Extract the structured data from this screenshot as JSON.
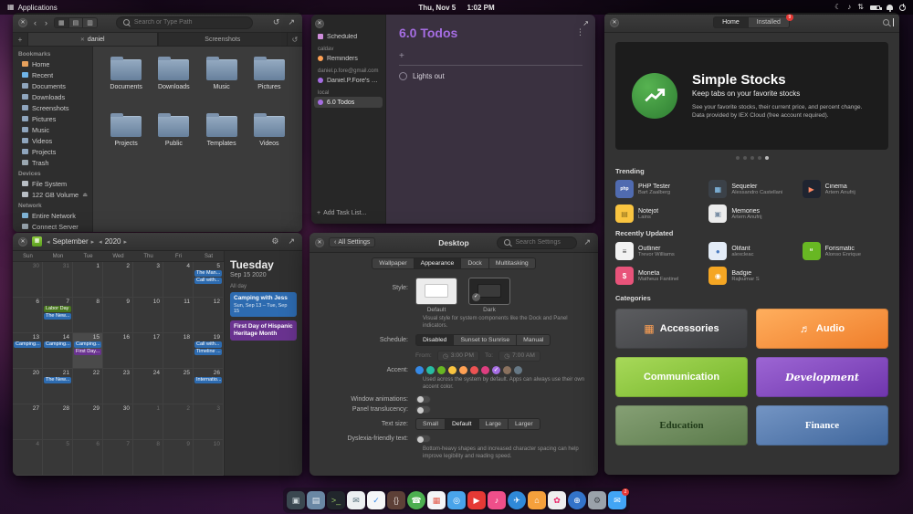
{
  "accent": "#a56de2",
  "panel": {
    "applications_label": "Applications",
    "date": "Thu, Nov 5",
    "time": "1:02 PM"
  },
  "files": {
    "search_placeholder": "Search or Type Path",
    "tabs": [
      {
        "label": "daniel",
        "active": true
      },
      {
        "label": "Screenshots",
        "active": false
      }
    ],
    "sidebar": [
      {
        "header": "Bookmarks",
        "items": [
          {
            "label": "Home",
            "icon": "home",
            "color": "#e7a15c"
          },
          {
            "label": "Recent",
            "icon": "recent",
            "color": "#6fb4e8"
          },
          {
            "label": "Documents",
            "icon": "folder",
            "color": "#8fa5bd"
          },
          {
            "label": "Downloads",
            "icon": "folder",
            "color": "#8fa5bd"
          },
          {
            "label": "Screenshots",
            "icon": "folder",
            "color": "#8fa5bd"
          },
          {
            "label": "Pictures",
            "icon": "folder",
            "color": "#8fa5bd"
          },
          {
            "label": "Music",
            "icon": "folder",
            "color": "#8fa5bd"
          },
          {
            "label": "Videos",
            "icon": "folder",
            "color": "#8fa5bd"
          },
          {
            "label": "Projects",
            "icon": "folder",
            "color": "#8fa5bd"
          },
          {
            "label": "Trash",
            "icon": "trash",
            "color": "#9aa7b0"
          }
        ]
      },
      {
        "header": "Devices",
        "items": [
          {
            "label": "File System",
            "icon": "drive",
            "color": "#b8bec4"
          },
          {
            "label": "122 GB Volume",
            "icon": "drive",
            "color": "#b8bec4",
            "eject": true
          }
        ]
      },
      {
        "header": "Network",
        "items": [
          {
            "label": "Entire Network",
            "icon": "network",
            "color": "#7fb3d5"
          },
          {
            "label": "Connect Server",
            "icon": "server",
            "color": "#9aa7b0"
          }
        ]
      }
    ],
    "folders": [
      "Documents",
      "Downloads",
      "Music",
      "Pictures",
      "Projects",
      "Public",
      "Templates",
      "Videos"
    ]
  },
  "tasks": {
    "title": "6.0 Todos",
    "add_list_label": "Add Task List...",
    "sidebar": [
      {
        "type": "item",
        "label": "Scheduled",
        "dot": "#cf8ddb",
        "square": true
      },
      {
        "type": "header",
        "label": "caldav"
      },
      {
        "type": "item",
        "label": "Reminders",
        "dot": "#ffa154"
      },
      {
        "type": "header",
        "label": "daniel.p.fore@gmail.com"
      },
      {
        "type": "item",
        "label": "Daniel.P.Fore's list",
        "dot": "#a56de2"
      },
      {
        "type": "header",
        "label": "local"
      },
      {
        "type": "item",
        "label": "6.0 Todos",
        "dot": "#a56de2",
        "selected": true
      }
    ],
    "todos": [
      {
        "label": "Lights out",
        "done": false
      }
    ]
  },
  "calendar": {
    "month": "September",
    "year": "2020",
    "weekdays": [
      "Sun",
      "Mon",
      "Tue",
      "Wed",
      "Thu",
      "Fri",
      "Sat"
    ],
    "weeks": [
      [
        {
          "d": 30,
          "dim": true
        },
        {
          "d": 31,
          "dim": true
        },
        {
          "d": 1
        },
        {
          "d": 2
        },
        {
          "d": 3
        },
        {
          "d": 4
        },
        {
          "d": 5,
          "events": [
            {
              "t": "The Man...",
              "c": "blue"
            },
            {
              "t": "Call with...",
              "c": "blue"
            }
          ]
        }
      ],
      [
        {
          "d": 6
        },
        {
          "d": 7,
          "events": [
            {
              "t": "Labor Day",
              "c": "green"
            },
            {
              "t": "The New...",
              "c": "blue"
            }
          ]
        },
        {
          "d": 8
        },
        {
          "d": 9
        },
        {
          "d": 10
        },
        {
          "d": 11
        },
        {
          "d": 12
        }
      ],
      [
        {
          "d": 13,
          "events": [
            {
              "t": "Camping...",
              "c": "blue"
            }
          ]
        },
        {
          "d": 14,
          "events": [
            {
              "t": "Camping...",
              "c": "blue"
            }
          ]
        },
        {
          "d": 15,
          "selected": true,
          "events": [
            {
              "t": "Camping...",
              "c": "blue"
            },
            {
              "t": "First Day...",
              "c": "purple"
            }
          ]
        },
        {
          "d": 16
        },
        {
          "d": 17
        },
        {
          "d": 18
        },
        {
          "d": 19,
          "events": [
            {
              "t": "Call with...",
              "c": "blue"
            },
            {
              "t": "Timeline ...",
              "c": "blue"
            }
          ]
        }
      ],
      [
        {
          "d": 20
        },
        {
          "d": 21,
          "events": [
            {
              "t": "The New...",
              "c": "blue"
            }
          ]
        },
        {
          "d": 22
        },
        {
          "d": 23
        },
        {
          "d": 24
        },
        {
          "d": 25
        },
        {
          "d": 26,
          "events": [
            {
              "t": "Internatio...",
              "c": "blue"
            }
          ]
        }
      ],
      [
        {
          "d": 27
        },
        {
          "d": 28
        },
        {
          "d": 29
        },
        {
          "d": 30
        },
        {
          "d": 1,
          "dim": true
        },
        {
          "d": 2,
          "dim": true
        },
        {
          "d": 3,
          "dim": true
        }
      ],
      [
        {
          "d": 4,
          "dim": true
        },
        {
          "d": 5,
          "dim": true
        },
        {
          "d": 6,
          "dim": true
        },
        {
          "d": 7,
          "dim": true
        },
        {
          "d": 8,
          "dim": true
        },
        {
          "d": 9,
          "dim": true
        },
        {
          "d": 10,
          "dim": true
        }
      ]
    ],
    "agenda": {
      "weekday": "Tuesday",
      "date": "Sep 15 2020",
      "allday_label": "All day",
      "events": [
        {
          "title": "Camping with Jess",
          "detail": "Sun, Sep 13 – Tue, Sep 15",
          "color": "blue"
        },
        {
          "title": "First Day of Hispanic Heritage Month",
          "detail": "",
          "color": "purple"
        }
      ]
    }
  },
  "settings": {
    "back_label": "All Settings",
    "title": "Desktop",
    "search_placeholder": "Search Settings",
    "tabs": [
      "Wallpaper",
      "Appearance",
      "Dock",
      "Multitasking"
    ],
    "active_tab": "Appearance",
    "style": {
      "label": "Style:",
      "options": [
        {
          "name": "Default",
          "dark": false,
          "selected": false
        },
        {
          "name": "Dark",
          "dark": true,
          "selected": true
        }
      ],
      "caption": "Visual style for system components like the Dock and Panel indicators."
    },
    "schedule": {
      "label": "Schedule:",
      "options": [
        "Disabled",
        "Sunset to Sunrise",
        "Manual"
      ],
      "selected": "Disabled",
      "from_label": "From:",
      "from": "3:00 PM",
      "to_label": "To:",
      "to": "7:00 AM"
    },
    "accent": {
      "label": "Accent:",
      "selected": "Grape",
      "colors": [
        {
          "name": "Blueberry",
          "hex": "#3689e6"
        },
        {
          "name": "Mint",
          "hex": "#28bca3"
        },
        {
          "name": "Lime",
          "hex": "#68b723"
        },
        {
          "name": "Banana",
          "hex": "#f9c440"
        },
        {
          "name": "Orange",
          "hex": "#ffa154"
        },
        {
          "name": "Strawberry",
          "hex": "#ed5353"
        },
        {
          "name": "Bubblegum",
          "hex": "#de3e80"
        },
        {
          "name": "Grape",
          "hex": "#a56de2"
        },
        {
          "name": "Cocoa",
          "hex": "#8a715e"
        },
        {
          "name": "Slate",
          "hex": "#667885"
        }
      ],
      "caption": "Used across the system by default. Apps can always use their own accent color."
    },
    "toggles": [
      {
        "label": "Window animations:",
        "on": false
      },
      {
        "label": "Panel translucency:",
        "on": false
      }
    ],
    "text_size": {
      "label": "Text size:",
      "options": [
        "Small",
        "Default",
        "Large",
        "Larger"
      ],
      "selected": "Default"
    },
    "dyslexia": {
      "label": "Dyslexia-friendly text:",
      "on": false,
      "caption": "Bottom-heavy shapes and increased character spacing can help improve legibility and reading speed."
    }
  },
  "appcenter": {
    "tabs": [
      {
        "label": "Home",
        "active": true
      },
      {
        "label": "Installed",
        "active": false,
        "badge": "9"
      }
    ],
    "banner": {
      "title": "Simple Stocks",
      "subtitle": "Keep tabs on your favorite stocks",
      "body": "See your favorite stocks, their current price, and percent change. Data provided by IEX Cloud (free account required)."
    },
    "carousel": {
      "count": 5,
      "active": 4
    },
    "sections": [
      {
        "title": "Trending",
        "apps": [
          {
            "name": "PHP Tester",
            "author": "Bart Zaalberg",
            "color": "#506bb0",
            "glyph": "php",
            "glyph_size": "5px"
          },
          {
            "name": "Sequeler",
            "author": "Alessandro Castellani",
            "color": "#3b4148",
            "glyph": "▦",
            "glyph_color": "#8fd0ff"
          },
          {
            "name": "Cinema",
            "author": "Artem Anufrij",
            "color": "#1f2430",
            "glyph": "▶",
            "glyph_color": "#ff8a65"
          },
          {
            "name": "Notejot",
            "author": "Lains",
            "color": "#f9c440",
            "glyph": "▤",
            "glyph_color": "#8a6d1a"
          },
          {
            "name": "Memories",
            "author": "Artem Anufrij",
            "color": "#ececec",
            "glyph": "▣",
            "glyph_color": "#7b8fa5"
          }
        ]
      },
      {
        "title": "Recently Updated",
        "apps": [
          {
            "name": "Outliner",
            "author": "Trevor Williams",
            "color": "#f2f2f2",
            "glyph": "≡",
            "glyph_color": "#444444"
          },
          {
            "name": "Olifant",
            "author": "alexcleac",
            "color": "#e3ecf7",
            "glyph": "●",
            "glyph_color": "#4a7bc0"
          },
          {
            "name": "Forismatic",
            "author": "Alonso Enrique",
            "color": "#68b723",
            "glyph": "“",
            "glyph_color": "#ffffff"
          },
          {
            "name": "Moneta",
            "author": "Matheus Fantinel",
            "color": "#e8537a",
            "glyph": "$",
            "glyph_color": "#ffffff"
          },
          {
            "name": "Badgie",
            "author": "Rajkumar S",
            "color": "#f5a623",
            "glyph": "◉",
            "glyph_color": "#ffffff"
          }
        ]
      }
    ],
    "categories_title": "Categories",
    "categories": [
      {
        "name": "Accessories",
        "bg1": "#5c5d60",
        "bg2": "#3c3d40",
        "glyph": "▦",
        "glyph_color": "#ffa154",
        "font": "sans",
        "text_color": "#ffffff"
      },
      {
        "name": "Audio",
        "bg1": "#ffaf5e",
        "bg2": "#ef7d2a",
        "glyph": "♬",
        "glyph_color": "#ffffff",
        "font": "sans",
        "text_color": "#ffffff"
      },
      {
        "name": "Communication",
        "bg1": "#a8d95a",
        "bg2": "#74b529",
        "font": "sans",
        "text_color": "#ffffff"
      },
      {
        "name": "Development",
        "bg1": "#9d66d4",
        "bg2": "#6f35ad",
        "font": "script",
        "text_color": "#ffffff"
      },
      {
        "name": "Education",
        "bg1": "#86a075",
        "bg2": "#5a7a4a",
        "font": "serif",
        "text_color": "#1f3a18"
      },
      {
        "name": "Finance",
        "bg1": "#7495c4",
        "bg2": "#3f669c",
        "font": "serif",
        "text_color": "#ffffff"
      }
    ]
  },
  "dock": [
    {
      "name": "multitasking-view",
      "bg": "#3a4750",
      "glyph": "▣",
      "glyph_color": "#cfd8dc"
    },
    {
      "name": "files",
      "bg": "#6a87a4",
      "glyph": "▤",
      "glyph_color": "#e8eef4"
    },
    {
      "name": "terminal",
      "bg": "#21262c",
      "glyph": ">_",
      "glyph_color": "#9ccc65"
    },
    {
      "name": "mail",
      "bg": "#eceff1",
      "glyph": "✉",
      "glyph_color": "#546e7a"
    },
    {
      "name": "tasks",
      "bg": "#f5f6f7",
      "glyph": "✓",
      "glyph_color": "#3689e6"
    },
    {
      "name": "code",
      "bg": "#5d4037",
      "glyph": "{}",
      "glyph_color": "#d7ccc8"
    },
    {
      "name": "chat",
      "bg": "#4caf50",
      "glyph": "☎",
      "glyph_color": "#ffffff",
      "round": true
    },
    {
      "name": "calendar",
      "bg": "#f4f5f7",
      "glyph": "▦",
      "glyph_color": "#e25a4a"
    },
    {
      "name": "camera",
      "bg": "#49a4ea",
      "glyph": "◎",
      "glyph_color": "#ffffff"
    },
    {
      "name": "youtube",
      "bg": "#e53935",
      "glyph": "▶",
      "glyph_color": "#ffffff"
    },
    {
      "name": "music",
      "bg": "#ef4f8a",
      "glyph": "♪",
      "glyph_color": "#ffffff"
    },
    {
      "name": "telegram",
      "bg": "#2f89d8",
      "glyph": "✈",
      "glyph_color": "#ffffff",
      "round": true
    },
    {
      "name": "appcenter",
      "bg": "#f5a03c",
      "glyph": "⌂",
      "glyph_color": "#ffffff"
    },
    {
      "name": "photos",
      "bg": "#eeeeee",
      "glyph": "✿",
      "glyph_color": "#e91e63"
    },
    {
      "name": "browser",
      "bg": "#3373c9",
      "glyph": "⊕",
      "glyph_color": "#ffffff",
      "round": true
    },
    {
      "name": "settings",
      "bg": "#9aa2aa",
      "glyph": "⚙",
      "glyph_color": "#42474c"
    },
    {
      "name": "messages",
      "bg": "#42a5f5",
      "glyph": "✉",
      "glyph_color": "#ffffff",
      "badge": "2"
    }
  ]
}
